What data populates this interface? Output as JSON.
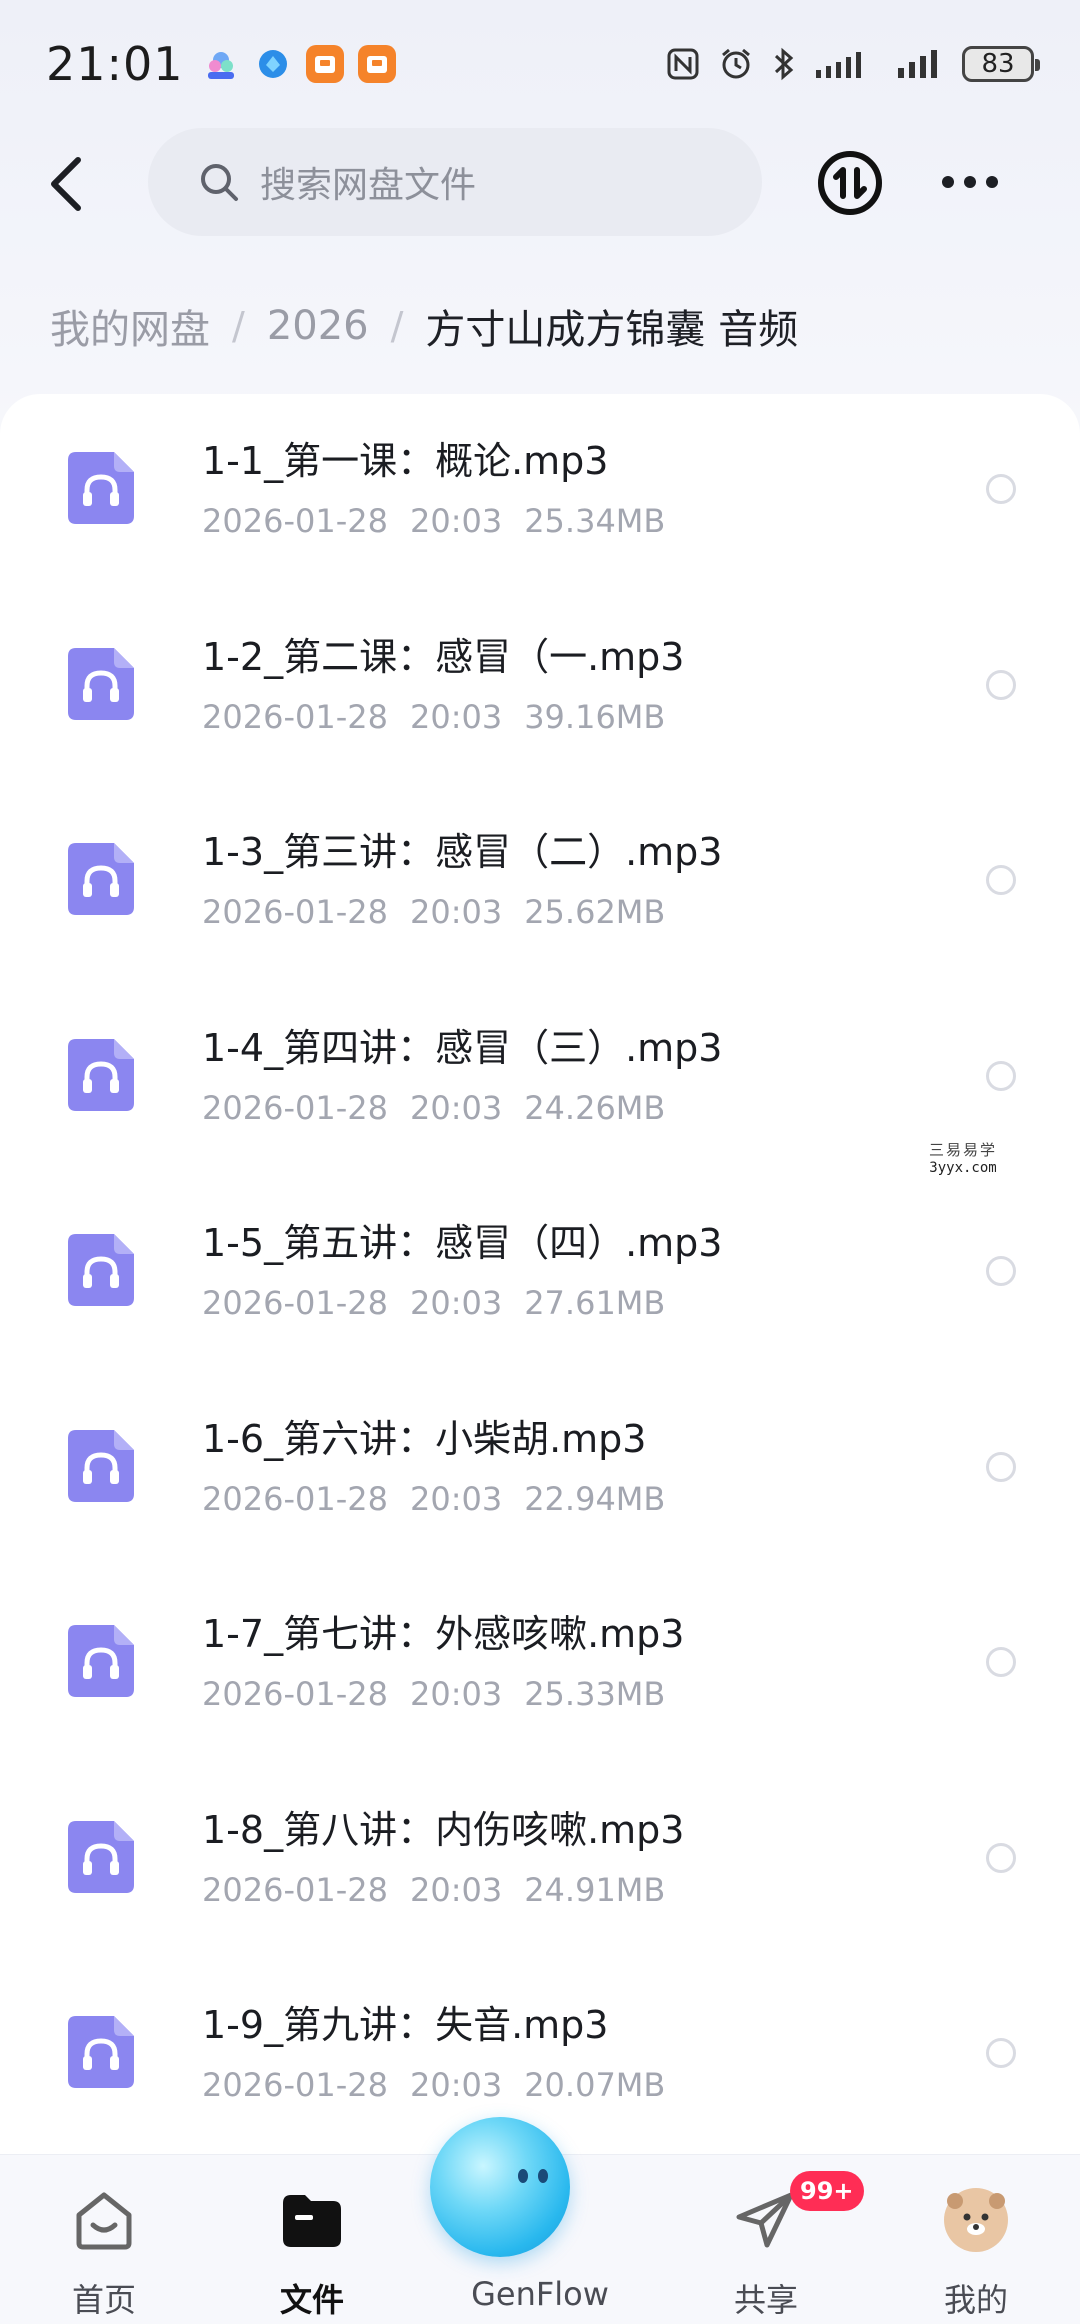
{
  "status_bar": {
    "time": "21:01",
    "battery": "83",
    "app_icons": [
      "genflow-app-icon",
      "browser-app-icon",
      "orange-app-icon",
      "orange-app-icon"
    ],
    "indicators": [
      "nfc-icon",
      "alarm-icon",
      "bluetooth-icon",
      "signal-icon",
      "signal-icon"
    ]
  },
  "header": {
    "search_placeholder": "搜索网盘文件"
  },
  "breadcrumb": {
    "items": [
      "我的网盘",
      "2026"
    ],
    "current": "方寸山成方锦囊 音频"
  },
  "files": [
    {
      "name": "1-1_第一课：概论.mp3",
      "date": "2026-01-28",
      "time": "20:03",
      "size": "25.34MB"
    },
    {
      "name": "1-2_第二课：感冒（一.mp3",
      "date": "2026-01-28",
      "time": "20:03",
      "size": "39.16MB"
    },
    {
      "name": "1-3_第三讲：感冒（二）.mp3",
      "date": "2026-01-28",
      "time": "20:03",
      "size": "25.62MB"
    },
    {
      "name": "1-4_第四讲：感冒（三）.mp3",
      "date": "2026-01-28",
      "time": "20:03",
      "size": "24.26MB"
    },
    {
      "name": "1-5_第五讲：感冒（四）.mp3",
      "date": "2026-01-28",
      "time": "20:03",
      "size": "27.61MB"
    },
    {
      "name": "1-6_第六讲：小柴胡.mp3",
      "date": "2026-01-28",
      "time": "20:03",
      "size": "22.94MB"
    },
    {
      "name": "1-7_第七讲：外感咳嗽.mp3",
      "date": "2026-01-28",
      "time": "20:03",
      "size": "25.33MB"
    },
    {
      "name": "1-8_第八讲：内伤咳嗽.mp3",
      "date": "2026-01-28",
      "time": "20:03",
      "size": "24.91MB"
    },
    {
      "name": "1-9_第九讲：失音.mp3",
      "date": "2026-01-28",
      "time": "20:03",
      "size": "20.07MB"
    }
  ],
  "watermark": {
    "line1": "三易易学",
    "line2": "3yyx.com"
  },
  "bottom_nav": {
    "items": [
      {
        "label": "首页",
        "icon": "home-icon"
      },
      {
        "label": "文件",
        "icon": "folder-icon",
        "active": true
      },
      {
        "label": "GenFlow",
        "icon": "genflow-orb-icon"
      },
      {
        "label": "共享",
        "icon": "paper-plane-icon",
        "badge": "99+"
      },
      {
        "label": "我的",
        "icon": "avatar-icon"
      }
    ]
  },
  "colors": {
    "accent_file_icon": "#8b86f0",
    "badge": "#ff2d55",
    "meta_text": "#a3a6b0"
  }
}
